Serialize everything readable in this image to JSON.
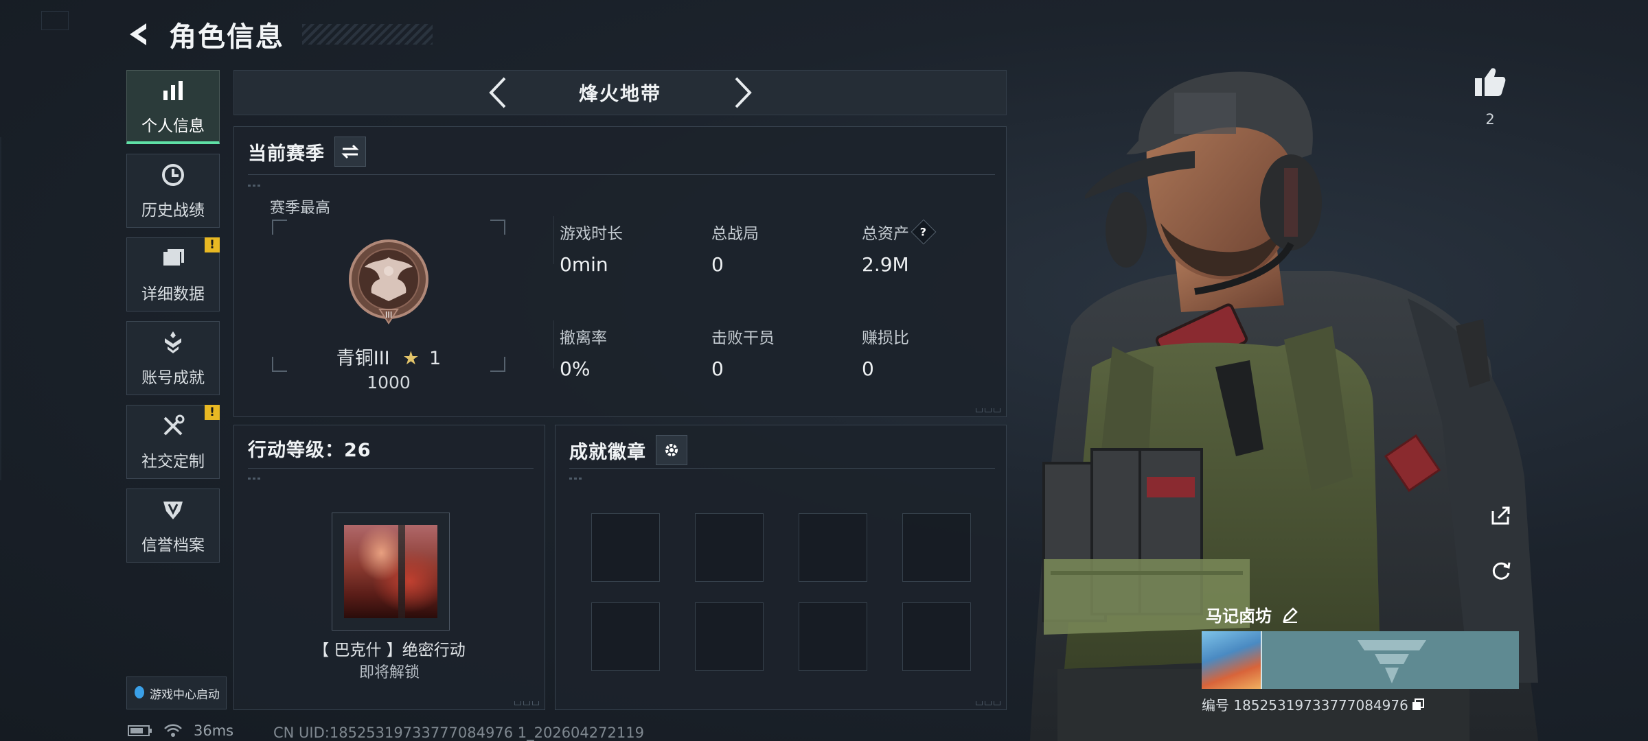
{
  "header": {
    "title": "角色信息"
  },
  "sidebar": {
    "items": [
      {
        "label": "个人信息",
        "icon": "bar-chart-icon",
        "active": true,
        "warning": false
      },
      {
        "label": "历史战绩",
        "icon": "clock-icon",
        "active": false,
        "warning": false
      },
      {
        "label": "详细数据",
        "icon": "folder-icon",
        "active": false,
        "warning": true
      },
      {
        "label": "账号成就",
        "icon": "achievement-icon",
        "active": false,
        "warning": false
      },
      {
        "label": "社交定制",
        "icon": "tools-icon",
        "active": false,
        "warning": true
      },
      {
        "label": "信誉档案",
        "icon": "shield-icon",
        "active": false,
        "warning": false
      }
    ],
    "warning_mark": "!",
    "game_center_label": "游戏中心启动"
  },
  "mode": {
    "title": "烽火地带"
  },
  "season": {
    "title": "当前赛季",
    "best_label": "赛季最高",
    "rank_name": "青铜III",
    "rank_stars": "1",
    "rank_score": "1000",
    "stats": [
      {
        "label": "游戏时长",
        "value": "0min"
      },
      {
        "label": "总战局",
        "value": "0"
      },
      {
        "label": "总资产",
        "value": "2.9M",
        "help": "?"
      },
      {
        "label": "撤离率",
        "value": "0%"
      },
      {
        "label": "击败干员",
        "value": "0"
      },
      {
        "label": "赚损比",
        "value": "0"
      }
    ]
  },
  "action_level": {
    "title": "行动等级：26",
    "operation_name": "【 巴克什 】绝密行动",
    "operation_status": "即将解锁"
  },
  "badges": {
    "title": "成就徽章",
    "slots": 8
  },
  "profile": {
    "likes": "2",
    "name": "马记卤坊",
    "id_line": "编号 18525319733777084976"
  },
  "status_bar": {
    "ping": "36ms",
    "uid": "CN UID:18525319733777084976 1_202604272119"
  },
  "colors": {
    "accent": "#5fe0a6",
    "warning": "#e8b823",
    "card_bg": "#5f8a92"
  }
}
